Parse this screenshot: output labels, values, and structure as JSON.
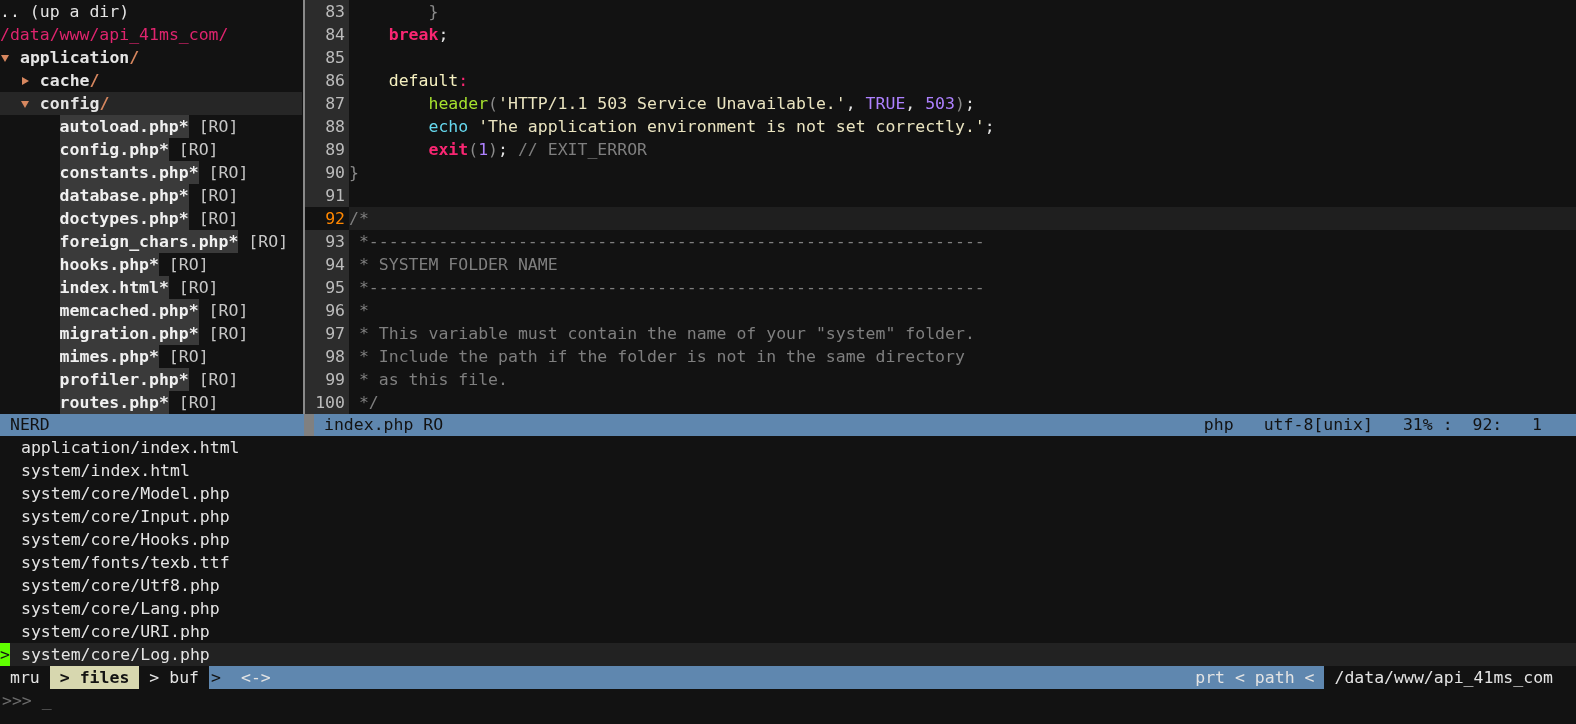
{
  "tree": {
    "up_dir": ".. (up a dir)",
    "root": "/data/www/api_41ms_com/",
    "nodes": [
      {
        "kind": "dir",
        "name": "application",
        "slash": "/",
        "expanded": true,
        "selected": false,
        "children": [
          {
            "kind": "dir",
            "name": "cache",
            "slash": "/",
            "expanded": false,
            "selected": false
          },
          {
            "kind": "dir",
            "name": "config",
            "slash": "/",
            "expanded": true,
            "selected": true,
            "children": [
              {
                "kind": "file",
                "name": "autoload.php*",
                "flag": "[RO]"
              },
              {
                "kind": "file",
                "name": "config.php*",
                "flag": "[RO]"
              },
              {
                "kind": "file",
                "name": "constants.php*",
                "flag": "[RO]"
              },
              {
                "kind": "file",
                "name": "database.php*",
                "flag": "[RO]"
              },
              {
                "kind": "file",
                "name": "doctypes.php*",
                "flag": "[RO]"
              },
              {
                "kind": "file",
                "name": "foreign_chars.php*",
                "flag": "[RO]"
              },
              {
                "kind": "file",
                "name": "hooks.php*",
                "flag": "[RO]"
              },
              {
                "kind": "file",
                "name": "index.html*",
                "flag": "[RO]"
              },
              {
                "kind": "file",
                "name": "memcached.php*",
                "flag": "[RO]"
              },
              {
                "kind": "file",
                "name": "migration.php*",
                "flag": "[RO]"
              },
              {
                "kind": "file",
                "name": "mimes.php*",
                "flag": "[RO]"
              },
              {
                "kind": "file",
                "name": "profiler.php*",
                "flag": "[RO]"
              },
              {
                "kind": "file",
                "name": "routes.php*",
                "flag": "[RO]"
              }
            ]
          }
        ]
      }
    ]
  },
  "code": [
    {
      "number": "83",
      "current": false,
      "tokens": [
        {
          "kind": "paren",
          "text": "        }"
        }
      ]
    },
    {
      "number": "84",
      "current": false,
      "tokens": [
        {
          "kind": "keyword",
          "text": "    break"
        },
        {
          "kind": "plain",
          "text": ";"
        }
      ]
    },
    {
      "number": "85",
      "current": false
    },
    {
      "number": "86",
      "current": false,
      "tokens": [
        {
          "kind": "label",
          "text": "    default"
        },
        {
          "kind": "operator",
          "text": ":"
        }
      ]
    },
    {
      "number": "87",
      "current": false,
      "tokens": [
        {
          "kind": "function",
          "text": "        header"
        },
        {
          "kind": "paren",
          "text": "("
        },
        {
          "kind": "string",
          "text": "'HTTP/1.1 503 Service Unavailable.'"
        },
        {
          "kind": "plain",
          "text": ","
        },
        {
          "kind": "constant",
          "text": " TRUE"
        },
        {
          "kind": "plain",
          "text": ","
        },
        {
          "kind": "constant",
          "text": " 503"
        },
        {
          "kind": "paren",
          "text": ")"
        },
        {
          "kind": "plain",
          "text": ";"
        }
      ]
    },
    {
      "number": "88",
      "current": false,
      "tokens": [
        {
          "kind": "builtin",
          "text": "        echo"
        },
        {
          "kind": "string",
          "text": " 'The application environment is not set correctly.'"
        },
        {
          "kind": "plain",
          "text": ";"
        }
      ]
    },
    {
      "number": "89",
      "current": false,
      "tokens": [
        {
          "kind": "keyword",
          "text": "        exit"
        },
        {
          "kind": "paren",
          "text": "("
        },
        {
          "kind": "constant",
          "text": "1"
        },
        {
          "kind": "paren",
          "text": ")"
        },
        {
          "kind": "plain",
          "text": ";"
        },
        {
          "kind": "comment",
          "text": " // EXIT_ERROR"
        }
      ]
    },
    {
      "number": "90",
      "current": false,
      "tokens": [
        {
          "kind": "paren",
          "text": "}"
        }
      ]
    },
    {
      "number": "91",
      "current": false
    },
    {
      "number": "92",
      "current": true,
      "tokens": [
        {
          "kind": "comment",
          "text": "/*"
        }
      ]
    },
    {
      "number": "93",
      "current": false,
      "tokens": [
        {
          "kind": "comment",
          "text": " *--------------------------------------------------------------"
        }
      ]
    },
    {
      "number": "94",
      "current": false,
      "tokens": [
        {
          "kind": "comment",
          "text": " * SYSTEM FOLDER NAME"
        }
      ]
    },
    {
      "number": "95",
      "current": false,
      "tokens": [
        {
          "kind": "comment",
          "text": " *--------------------------------------------------------------"
        }
      ]
    },
    {
      "number": "96",
      "current": false,
      "tokens": [
        {
          "kind": "comment",
          "text": " *"
        }
      ]
    },
    {
      "number": "97",
      "current": false,
      "tokens": [
        {
          "kind": "comment",
          "text": " * This variable must contain the name of your \"system\" folder."
        }
      ]
    },
    {
      "number": "98",
      "current": false,
      "tokens": [
        {
          "kind": "comment",
          "text": " * Include the path if the folder is not in the same directory"
        }
      ]
    },
    {
      "number": "99",
      "current": false,
      "tokens": [
        {
          "kind": "comment",
          "text": " * as this file."
        }
      ]
    },
    {
      "number": "100",
      "current": false,
      "tokens": [
        {
          "kind": "comment",
          "text": " */"
        }
      ]
    }
  ],
  "status_bar": {
    "left": "NERD",
    "file": "index.php RO",
    "right": [
      "php",
      "utf-8[unix]",
      "31% :  92:   1"
    ]
  },
  "mru": {
    "marker": ">",
    "items": [
      {
        "path": "application/index.html",
        "selected": false
      },
      {
        "path": "system/index.html",
        "selected": false
      },
      {
        "path": "system/core/Model.php",
        "selected": false
      },
      {
        "path": "system/core/Input.php",
        "selected": false
      },
      {
        "path": "system/core/Hooks.php",
        "selected": false
      },
      {
        "path": "system/fonts/texb.ttf",
        "selected": false
      },
      {
        "path": "system/core/Utf8.php",
        "selected": false
      },
      {
        "path": "system/core/Lang.php",
        "selected": false
      },
      {
        "path": "system/core/URI.php",
        "selected": false
      },
      {
        "path": "system/core/Log.php",
        "selected": true
      }
    ]
  },
  "ctrlp_bar": {
    "modes": [
      {
        "label": "mru",
        "selected": false
      },
      {
        "marker": ">",
        "label": "files",
        "selected": true
      },
      {
        "marker": ">",
        "label": "buf",
        "selected": false
      }
    ],
    "end_marker": ">",
    "focus": "<->",
    "right": "prt < path <",
    "cwd": "/data/www/api_41ms_com"
  },
  "command_line": {
    "prompt": ">>>",
    "cursor": "_"
  }
}
